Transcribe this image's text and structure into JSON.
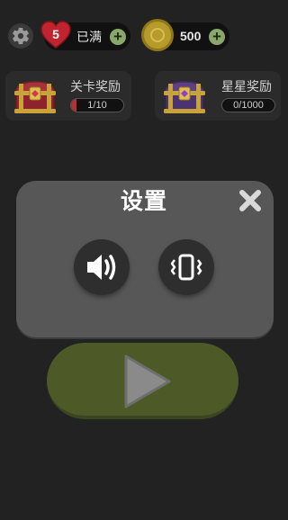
{
  "topbar": {
    "settings_icon": "gear-icon",
    "lives": {
      "count": "5",
      "status": "已满",
      "icon": "heart-icon"
    },
    "coins": {
      "amount": "500",
      "icon": "coin-icon"
    },
    "add_icon": "plus-circle-icon"
  },
  "rewards": {
    "level": {
      "title": "关卡奖励",
      "progress_text": "1/10",
      "progress_value": 0.1,
      "icon": "red-chest-icon"
    },
    "star": {
      "title": "星星奖励",
      "progress_text": "0/1000",
      "progress_value": 0,
      "icon": "purple-chest-icon"
    }
  },
  "dialog": {
    "title": "设置",
    "close_icon": "close-icon",
    "sound_icon": "speaker-icon",
    "vibrate_icon": "vibrate-icon"
  },
  "play": {
    "icon": "play-icon"
  },
  "colors": {
    "background": "#222222",
    "dialog": "#575757",
    "play_button": "#4d5a27",
    "progress_fill": "#b43131",
    "plus": "#8aa86b",
    "heart": "#c0252f",
    "coin": "#b79a2c"
  }
}
